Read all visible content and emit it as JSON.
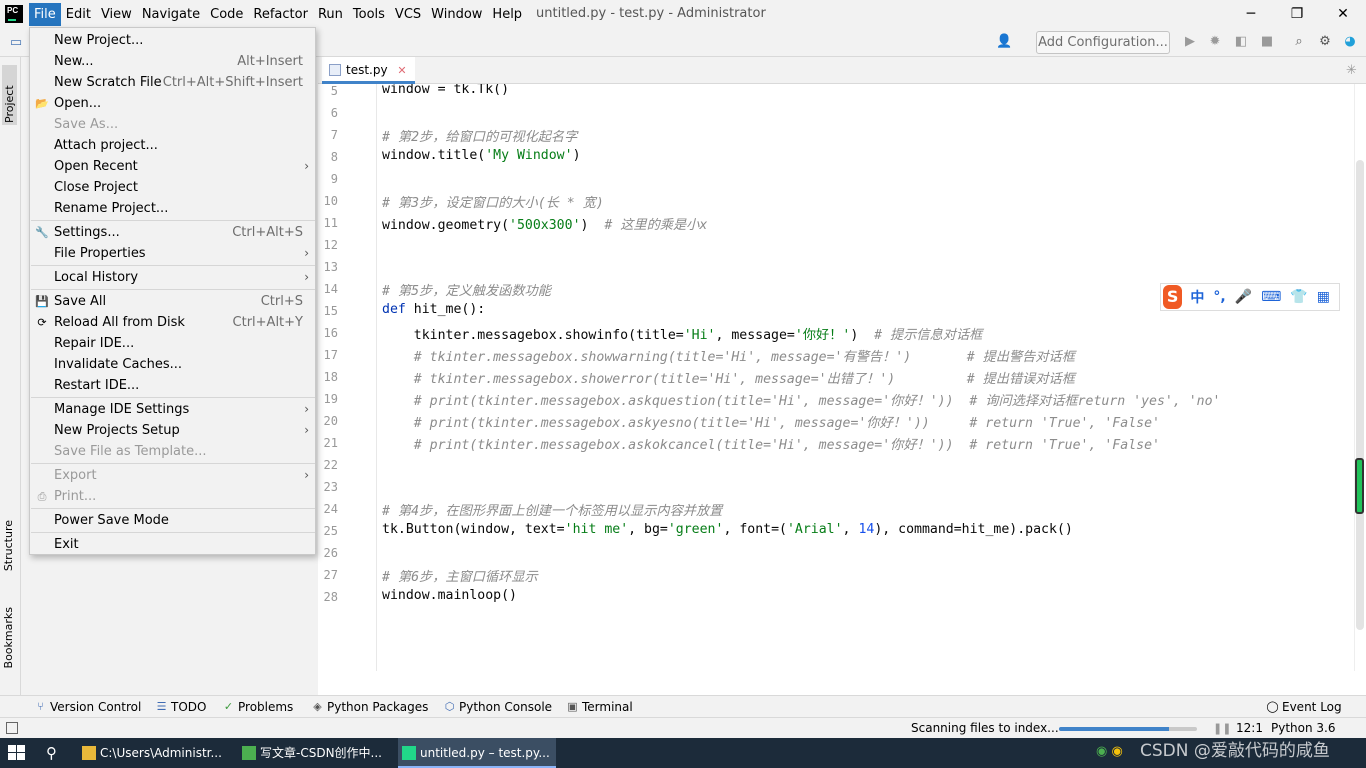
{
  "app": {
    "window_title": "untitled.py - test.py - Administrator",
    "logo": "PC"
  },
  "menubar": [
    "File",
    "Edit",
    "View",
    "Navigate",
    "Code",
    "Refactor",
    "Run",
    "Tools",
    "VCS",
    "Window",
    "Help"
  ],
  "toolbar": {
    "add_configuration": "Add Configuration...",
    "icons": [
      "user-icon",
      "run-icon",
      "debug-icon",
      "coverage-icon",
      "stop-icon",
      "search-icon",
      "settings-icon",
      "jetbrains-toolbox-icon"
    ]
  },
  "left_tabs": {
    "project": "Project",
    "structure": "Structure",
    "bookmarks": "Bookmarks"
  },
  "editor": {
    "tab_label": "test.py",
    "lines": [
      {
        "n": "5",
        "html": "window = tk.Tk()"
      },
      {
        "n": "6",
        "html": ""
      },
      {
        "n": "7",
        "html": "<span class=\"cm\"># 第2步，给窗口的可视化起名字</span>"
      },
      {
        "n": "8",
        "html": "window.title(<span class=\"str\">'My Window'</span>)"
      },
      {
        "n": "9",
        "html": ""
      },
      {
        "n": "10",
        "html": "<span class=\"cm\"># 第3步，设定窗口的大小(长 * 宽)</span>"
      },
      {
        "n": "11",
        "html": "window.geometry(<span class=\"str\">'500x300'</span>)  <span class=\"cm\"># 这里的乘是小x</span>"
      },
      {
        "n": "12",
        "html": ""
      },
      {
        "n": "13",
        "html": ""
      },
      {
        "n": "14",
        "html": "<span class=\"cm\"># 第5步，定义触发函数功能</span>"
      },
      {
        "n": "15",
        "html": "<span class=\"kw\">def</span> hit_me():"
      },
      {
        "n": "16",
        "html": "    tkinter.messagebox.showinfo(title=<span class=\"str\">'Hi'</span>, message=<span class=\"str\">'你好！'</span>)  <span class=\"cm\"># 提示信息对话框</span>"
      },
      {
        "n": "17",
        "html": "    <span class=\"cm\"># tkinter.messagebox.showwarning(title='Hi', message='有警告！')       # 提出警告对话框</span>"
      },
      {
        "n": "18",
        "html": "    <span class=\"cm\"># tkinter.messagebox.showerror(title='Hi', message='出错了！')         # 提出错误对话框</span>"
      },
      {
        "n": "19",
        "html": "    <span class=\"cm\"># print(tkinter.messagebox.askquestion(title='Hi', message='你好！'))  # 询问选择对话框return 'yes', 'no'</span>"
      },
      {
        "n": "20",
        "html": "    <span class=\"cm\"># print(tkinter.messagebox.askyesno(title='Hi', message='你好！'))     # return 'True', 'False'</span>"
      },
      {
        "n": "21",
        "html": "    <span class=\"cm\"># print(tkinter.messagebox.askokcancel(title='Hi', message='你好！'))  # return 'True', 'False'</span>"
      },
      {
        "n": "22",
        "html": ""
      },
      {
        "n": "23",
        "html": ""
      },
      {
        "n": "24",
        "html": "<span class=\"cm\"># 第4步，在图形界面上创建一个标签用以显示内容并放置</span>"
      },
      {
        "n": "25",
        "html": "tk.Button(window, text=<span class=\"str\">'hit me'</span>, bg=<span class=\"str\">'green'</span>, font=(<span class=\"str\">'Arial'</span>, <span class=\"num\">14</span>), command=hit_me).pack()"
      },
      {
        "n": "26",
        "html": ""
      },
      {
        "n": "27",
        "html": "<span class=\"cm\"># 第6步，主窗口循环显示</span>"
      },
      {
        "n": "28",
        "html": "window.mainloop()"
      }
    ]
  },
  "ime": {
    "logo": "S",
    "items": [
      "中",
      "°,",
      "🎤",
      "⌨",
      "👕",
      "▦"
    ]
  },
  "file_menu": [
    {
      "label": "New Project...",
      "shortcut": "",
      "arrow": false,
      "disabled": false,
      "icon": ""
    },
    {
      "label": "New...",
      "shortcut": "Alt+Insert",
      "arrow": false,
      "disabled": false,
      "icon": ""
    },
    {
      "label": "New Scratch File",
      "shortcut": "Ctrl+Alt+Shift+Insert",
      "arrow": false,
      "disabled": false,
      "icon": ""
    },
    {
      "label": "Open...",
      "shortcut": "",
      "arrow": false,
      "disabled": false,
      "icon": "folder"
    },
    {
      "label": "Save As...",
      "shortcut": "",
      "arrow": false,
      "disabled": true,
      "icon": ""
    },
    {
      "label": "Attach project...",
      "shortcut": "",
      "arrow": false,
      "disabled": false,
      "icon": ""
    },
    {
      "label": "Open Recent",
      "shortcut": "",
      "arrow": true,
      "disabled": false,
      "icon": ""
    },
    {
      "label": "Close Project",
      "shortcut": "",
      "arrow": false,
      "disabled": false,
      "icon": ""
    },
    {
      "label": "Rename Project...",
      "shortcut": "",
      "arrow": false,
      "disabled": false,
      "icon": ""
    },
    {
      "sep": true
    },
    {
      "label": "Settings...",
      "shortcut": "Ctrl+Alt+S",
      "arrow": false,
      "disabled": false,
      "icon": "wrench"
    },
    {
      "label": "File Properties",
      "shortcut": "",
      "arrow": true,
      "disabled": false,
      "icon": ""
    },
    {
      "sep": true
    },
    {
      "label": "Local History",
      "shortcut": "",
      "arrow": true,
      "disabled": false,
      "icon": ""
    },
    {
      "sep": true
    },
    {
      "label": "Save All",
      "shortcut": "Ctrl+S",
      "arrow": false,
      "disabled": false,
      "icon": "save"
    },
    {
      "label": "Reload All from Disk",
      "shortcut": "Ctrl+Alt+Y",
      "arrow": false,
      "disabled": false,
      "icon": "reload"
    },
    {
      "label": "Repair IDE...",
      "shortcut": "",
      "arrow": false,
      "disabled": false,
      "icon": ""
    },
    {
      "label": "Invalidate Caches...",
      "shortcut": "",
      "arrow": false,
      "disabled": false,
      "icon": ""
    },
    {
      "label": "Restart IDE...",
      "shortcut": "",
      "arrow": false,
      "disabled": false,
      "icon": ""
    },
    {
      "sep": true
    },
    {
      "label": "Manage IDE Settings",
      "shortcut": "",
      "arrow": true,
      "disabled": false,
      "icon": ""
    },
    {
      "label": "New Projects Setup",
      "shortcut": "",
      "arrow": true,
      "disabled": false,
      "icon": ""
    },
    {
      "label": "Save File as Template...",
      "shortcut": "",
      "arrow": false,
      "disabled": true,
      "icon": ""
    },
    {
      "sep": true
    },
    {
      "label": "Export",
      "shortcut": "",
      "arrow": true,
      "disabled": true,
      "icon": ""
    },
    {
      "label": "Print...",
      "shortcut": "",
      "arrow": false,
      "disabled": true,
      "icon": "print"
    },
    {
      "sep": true
    },
    {
      "label": "Power Save Mode",
      "shortcut": "",
      "arrow": false,
      "disabled": false,
      "icon": ""
    },
    {
      "sep": true
    },
    {
      "label": "Exit",
      "shortcut": "",
      "arrow": false,
      "disabled": false,
      "icon": ""
    }
  ],
  "tool_windows": [
    {
      "label": "Version Control",
      "icon": "branch-icon"
    },
    {
      "label": "TODO",
      "icon": "todo-icon"
    },
    {
      "label": "Problems",
      "icon": "check-icon"
    },
    {
      "label": "Python Packages",
      "icon": "package-icon"
    },
    {
      "label": "Python Console",
      "icon": "python-icon"
    },
    {
      "label": "Terminal",
      "icon": "terminal-icon"
    }
  ],
  "event_log": "Event Log",
  "status": {
    "scanning": "Scanning files to index...",
    "progress": 0.8,
    "position": "12:1",
    "interpreter": "Python 3.6"
  },
  "taskbar": {
    "tasks": [
      {
        "label": "C:\\Users\\Administr...",
        "color": "#e8b83a"
      },
      {
        "label": "写文章-CSDN创作中...",
        "color": "#4caf50"
      },
      {
        "label": "untitled.py – test.py...",
        "color": "#21d789"
      }
    ],
    "watermark": "CSDN @爱敲代码的咸鱼"
  }
}
